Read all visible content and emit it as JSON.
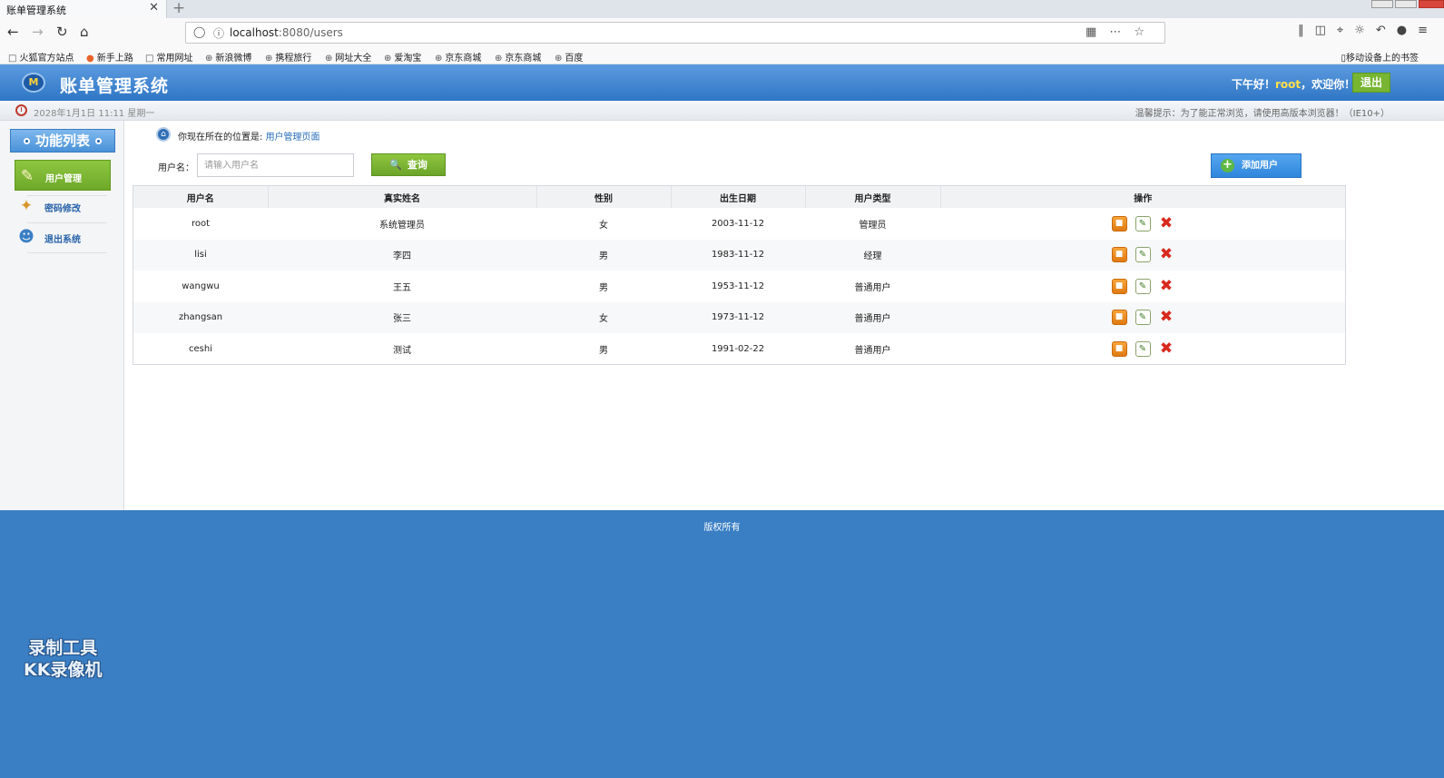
{
  "browser": {
    "tab_title": "账单管理系统",
    "tab_close": "✕",
    "new_tab": "+",
    "url_host": "localhost",
    "url_path": ":8080/users",
    "bookmarks": [
      "火狐官方站点",
      "新手上路",
      "常用网址",
      "新浪微博",
      "携程旅行",
      "网址大全",
      "爱淘宝",
      "京东商城",
      "京东商城",
      "百度"
    ],
    "mobile_bookmarks": "移动设备上的书签"
  },
  "header": {
    "logo": "M",
    "title": "账单管理系统",
    "greeting_prefix": "下午好！",
    "username": "root",
    "greeting_suffix": "，欢迎你！",
    "logout": "退出"
  },
  "infobar": {
    "datetime": "2028年1月1日 11:11 星期一",
    "tip": "温馨提示：为了能正常浏览，请使用高版本浏览器！（IE10+）"
  },
  "sidebar": {
    "title": "功能列表",
    "items": [
      {
        "label": "用户管理",
        "icon": "✎"
      },
      {
        "label": "密码修改",
        "icon": "✦"
      },
      {
        "label": "退出系统",
        "icon": "☻"
      }
    ]
  },
  "main": {
    "breadcrumb_prefix": "你现在所在的位置是:",
    "breadcrumb_current": "用户管理页面",
    "search_label": "用户名：",
    "search_placeholder": "请输入用户名",
    "query_button": "查询",
    "add_button": "添加用户"
  },
  "table": {
    "headers": [
      "用户名",
      "真实姓名",
      "性别",
      "出生日期",
      "用户类型",
      "操作"
    ],
    "rows": [
      [
        "root",
        "系统管理员",
        "女",
        "2003-11-12",
        "管理员"
      ],
      [
        "lisi",
        "李四",
        "男",
        "1983-11-12",
        "经理"
      ],
      [
        "wangwu",
        "王五",
        "男",
        "1953-11-12",
        "普通用户"
      ],
      [
        "zhangsan",
        "张三",
        "女",
        "1973-11-12",
        "普通用户"
      ],
      [
        "ceshi",
        "测试",
        "男",
        "1991-02-22",
        "普通用户"
      ]
    ]
  },
  "footer": {
    "copyright": "版权所有",
    "watermark_line1": "录制工具",
    "watermark_line2": "KK录像机"
  },
  "colors": {
    "header_blue": "#2f76c5",
    "accent_green": "#77b532",
    "footer_blue": "#3a7fc4"
  }
}
